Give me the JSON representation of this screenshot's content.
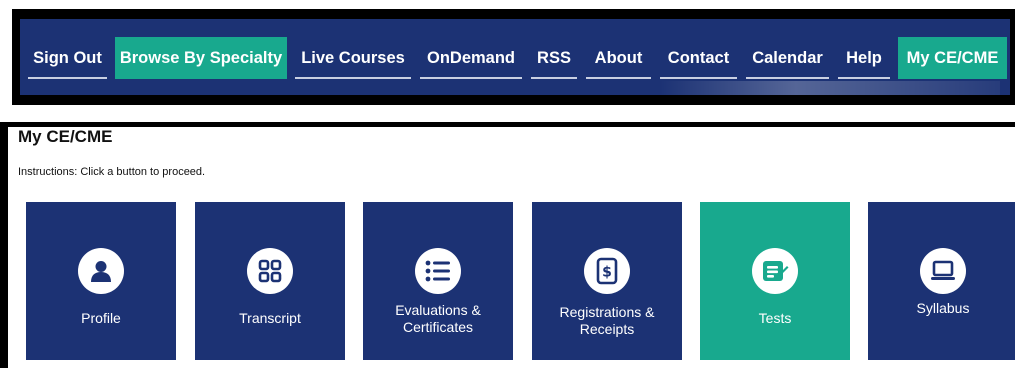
{
  "nav": {
    "items": [
      {
        "label": "Sign Out"
      },
      {
        "label": "Browse By Specialty"
      },
      {
        "label": "Live Courses"
      },
      {
        "label": "OnDemand"
      },
      {
        "label": "RSS"
      },
      {
        "label": "About"
      },
      {
        "label": "Contact"
      },
      {
        "label": "Calendar"
      },
      {
        "label": "Help"
      },
      {
        "label": "My CE/CME"
      }
    ],
    "active_items": [
      "Browse By Specialty",
      "My CE/CME"
    ]
  },
  "page": {
    "title": "My CE/CME",
    "instructions": "Instructions: Click a button to proceed."
  },
  "tiles": [
    {
      "label": "Profile",
      "icon": "user-icon"
    },
    {
      "label": "Transcript",
      "icon": "grid-icon"
    },
    {
      "label": "Evaluations & Certificates",
      "line1": "Evaluations &",
      "line2": "Certificates",
      "icon": "list-icon"
    },
    {
      "label": "Registrations & Receipts",
      "line1": "Registrations &",
      "line2": "Receipts",
      "icon": "receipt-dollar-icon"
    },
    {
      "label": "Tests",
      "icon": "test-document-icon"
    },
    {
      "label": "Syllabus",
      "icon": "laptop-icon"
    }
  ],
  "colors": {
    "navy": "#1c3274",
    "teal": "#18a98e",
    "white": "#ffffff"
  }
}
